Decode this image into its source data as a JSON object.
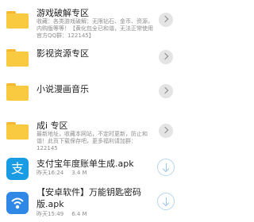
{
  "items": [
    {
      "title": "游戏破解专区",
      "desc": "收藏：各类游戏破解：无限钻石、金币、资源，内购版等等！【黄化包全已和谐，无法正常使用 官方QQ群：122145】",
      "action": "chevron-right-icon"
    },
    {
      "title": "影视资源专区",
      "action": "chevron-right-icon"
    },
    {
      "title": "小说漫画音乐",
      "action": "chevron-right-icon"
    },
    {
      "title": "成ⅰ 专区",
      "desc": "最新地址，收藏本网站，不定时更新，防止和谐！此页下载保存吧，更多福利请加群：122145",
      "action": "chevron-right-icon"
    },
    {
      "title": "支付宝年度账单生成.apk",
      "time": "昨天16:24",
      "size": "3.4 M",
      "icon": "alipay-icon",
      "icon_glyph": "支",
      "action": "download-icon"
    },
    {
      "title": "【安卓软件】万能钥匙密码版.apk",
      "title_line1": "【安卓软件】万能钥匙密码",
      "title_line2": "版.apk",
      "time": "昨天15:49",
      "size": "6.4 M",
      "icon": "wifi-key-icon",
      "action": "download-icon"
    }
  ],
  "colors": {
    "folder": "#f9c93f",
    "alipay": "#1a9ce4",
    "wifikey": "#2f88e6",
    "download": "#9cc3ea"
  }
}
